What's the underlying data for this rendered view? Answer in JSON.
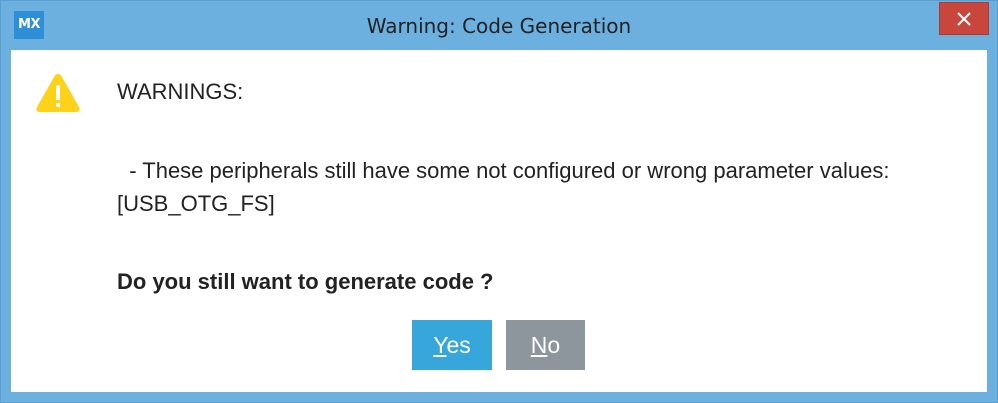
{
  "window": {
    "app_icon": "MX",
    "title": "Warning: Code Generation",
    "close_icon": "close-icon"
  },
  "dialog": {
    "icon": "warning-icon",
    "heading": "WARNINGS:",
    "message_line1": "  - These peripherals still have some not configured or wrong parameter values:",
    "message_line2": "[USB_OTG_FS]",
    "question": "Do you still want to generate code ?"
  },
  "buttons": {
    "yes": {
      "mnemonic": "Y",
      "rest": "es"
    },
    "no": {
      "mnemonic": "N",
      "rest": "o"
    }
  },
  "colors": {
    "titlebar": "#6cb0e0",
    "close_button": "#c9463c",
    "yes_button": "#36a6db",
    "no_button": "#8d969c",
    "warning_icon": "#ffd21a"
  }
}
